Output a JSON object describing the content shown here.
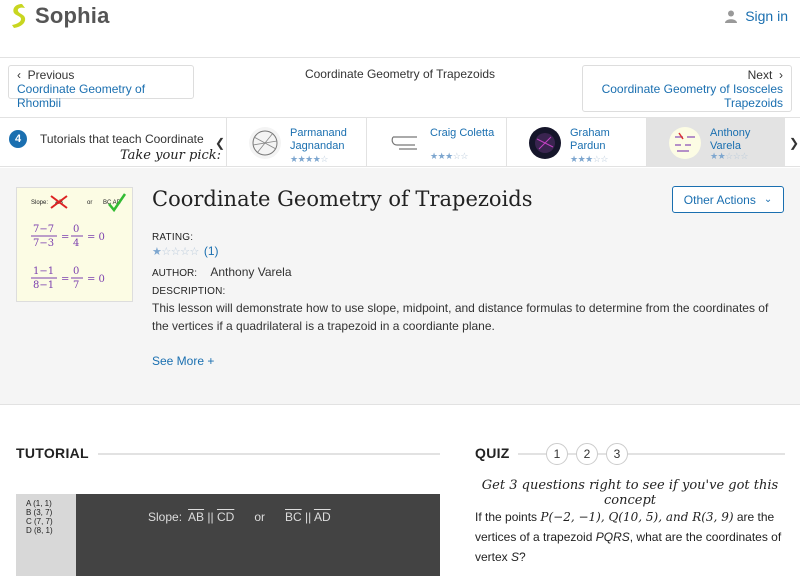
{
  "header": {
    "brand": "Sophia",
    "signin_label": "Sign in"
  },
  "nav": {
    "prev_label": "Previous",
    "prev_link": "Coordinate Geometry of Rhombii",
    "center_title": "Coordinate Geometry of Trapezoids",
    "next_label": "Next",
    "next_link_1": "Coordinate Geometry of Isosceles",
    "next_link_2": "Trapezoids"
  },
  "tutorials": {
    "count": "4",
    "text": "Tutorials that teach Coordinate",
    "pick": "Take your pick:",
    "cards": [
      {
        "name_1": "Parmanand",
        "name_2": "Jagnandan",
        "stars": 4
      },
      {
        "name_1": "Craig Coletta",
        "name_2": "",
        "stars": 3
      },
      {
        "name_1": "Graham",
        "name_2": "Pardun",
        "stars": 3
      },
      {
        "name_1": "Anthony Varela",
        "name_2": "",
        "stars": 2
      }
    ]
  },
  "lesson": {
    "title": "Coordinate Geometry of Trapezoids",
    "other_actions": "Other Actions",
    "rating_label": "RATING:",
    "rating_stars": 1,
    "rating_count": "(1)",
    "author_label": "AUTHOR:",
    "author_name": "Anthony Varela",
    "description_label": "DESCRIPTION:",
    "description": "This lesson will demonstrate how to use slope, midpoint, and distance formulas to determine from the coordinates of the vertices if a quadrilateral is a trapezoid in a coordiante plane.",
    "see_more": "See More +",
    "thumb_header": "Slope: AB or BC AD"
  },
  "tutorial": {
    "heading": "TUTORIAL",
    "video_points": [
      "A (1, 1)",
      "B (3, 7)",
      "C (7, 7)",
      "D (8, 1)"
    ],
    "video_slope_label": "Slope:",
    "video_or": "or"
  },
  "quiz": {
    "heading": "QUIZ",
    "numbers": [
      "1",
      "2",
      "3"
    ],
    "cta": "Get 3 questions right to see if you've got this concept",
    "question_prefix": "If the points",
    "question_points": "P(−2, −1), Q(10, 5), and R(3, 9)",
    "question_mid": "are the vertices of a trapezoid",
    "question_shape": "PQRS",
    "question_end": ", what are the coordinates of vertex",
    "question_vertex": "S",
    "question_mark": "?"
  },
  "colors": {
    "accent": "#1a6fb0",
    "logo": "#c8d620",
    "lesson_bg": "#f5f5f5"
  }
}
